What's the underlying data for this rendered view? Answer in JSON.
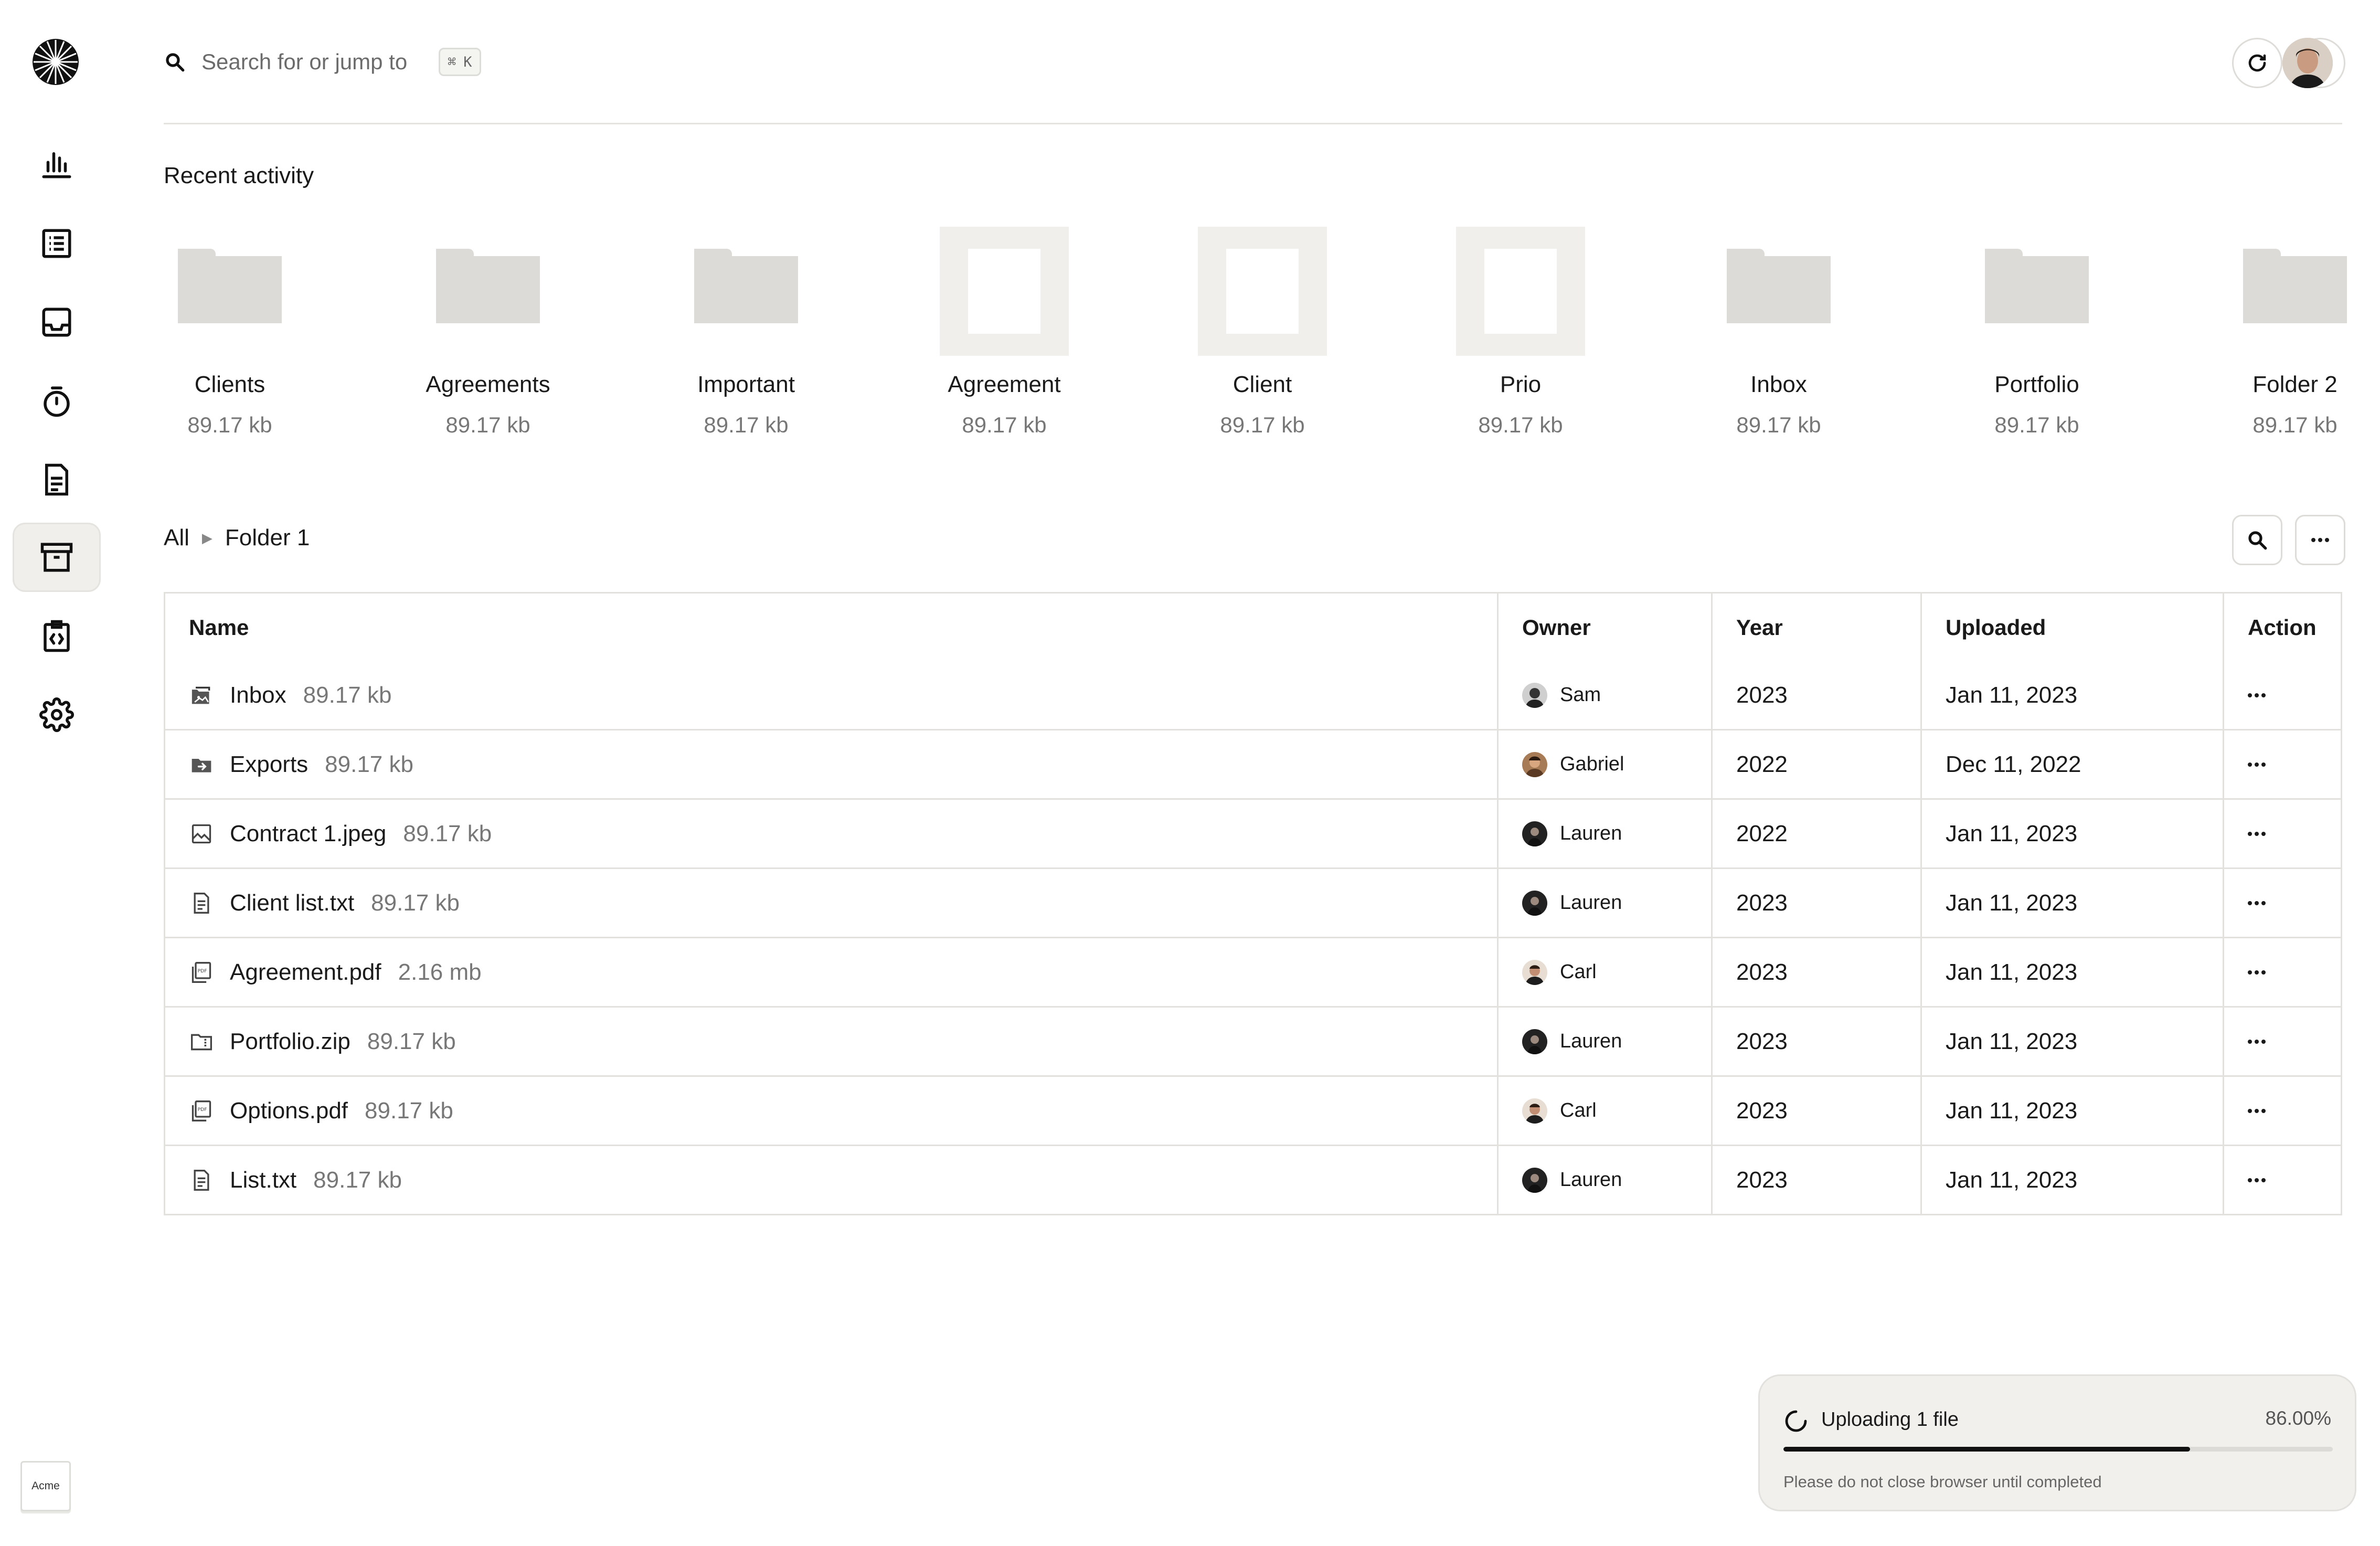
{
  "app": {
    "workspace_label": "Acme"
  },
  "search": {
    "placeholder": "Search for or jump to",
    "shortcut_symbol": "⌘",
    "shortcut_key": "K"
  },
  "sidebar": {
    "items": [
      {
        "icon": "bar-chart-icon",
        "active": false
      },
      {
        "icon": "list-icon",
        "active": false
      },
      {
        "icon": "inbox-icon",
        "active": false
      },
      {
        "icon": "timer-icon",
        "active": false
      },
      {
        "icon": "document-icon",
        "active": false
      },
      {
        "icon": "archive-icon",
        "active": true
      },
      {
        "icon": "code-file-icon",
        "active": false
      },
      {
        "icon": "gear-icon",
        "active": false
      }
    ]
  },
  "header_actions": [
    {
      "icon": "refresh-icon"
    },
    {
      "icon": "bell-icon"
    },
    {
      "icon": "user-avatar"
    }
  ],
  "recent": {
    "title": "Recent activity",
    "items": [
      {
        "name": "Clients",
        "size": "89.17 kb",
        "kind": "folder"
      },
      {
        "name": "Agreements",
        "size": "89.17 kb",
        "kind": "folder"
      },
      {
        "name": "Important",
        "size": "89.17 kb",
        "kind": "folder"
      },
      {
        "name": "Agreement",
        "size": "89.17 kb",
        "kind": "file"
      },
      {
        "name": "Client",
        "size": "89.17 kb",
        "kind": "file"
      },
      {
        "name": "Prio",
        "size": "89.17 kb",
        "kind": "file"
      },
      {
        "name": "Inbox",
        "size": "89.17 kb",
        "kind": "folder"
      },
      {
        "name": "Portfolio",
        "size": "89.17 kb",
        "kind": "folder"
      },
      {
        "name": "Folder 2",
        "size": "89.17 kb",
        "kind": "folder"
      }
    ]
  },
  "breadcrumb": {
    "root": "All",
    "current": "Folder 1"
  },
  "toolbar": [
    {
      "icon": "search-icon"
    },
    {
      "icon": "filter-icon"
    },
    {
      "icon": "more-icon"
    }
  ],
  "table": {
    "columns": {
      "name": "Name",
      "owner": "Owner",
      "year": "Year",
      "uploaded": "Uploaded",
      "action": "Action"
    },
    "rows": [
      {
        "icon": "image-folder-icon",
        "name": "Inbox",
        "size": "89.17 kb",
        "owner": "Sam",
        "year": "2023",
        "uploaded": "Jan 11, 2023"
      },
      {
        "icon": "folder-arrow-icon",
        "name": "Exports",
        "size": "89.17 kb",
        "owner": "Gabriel",
        "year": "2022",
        "uploaded": "Dec 11, 2022"
      },
      {
        "icon": "image-icon",
        "name": "Contract 1.jpeg",
        "size": "89.17 kb",
        "owner": "Lauren",
        "year": "2022",
        "uploaded": "Jan 11, 2023"
      },
      {
        "icon": "text-file-icon",
        "name": "Client list.txt",
        "size": "89.17 kb",
        "owner": "Lauren",
        "year": "2023",
        "uploaded": "Jan 11, 2023"
      },
      {
        "icon": "pdf-icon",
        "name": "Agreement.pdf",
        "size": "2.16 mb",
        "owner": "Carl",
        "year": "2023",
        "uploaded": "Jan 11, 2023"
      },
      {
        "icon": "zip-folder-icon",
        "name": "Portfolio.zip",
        "size": "89.17 kb",
        "owner": "Lauren",
        "year": "2023",
        "uploaded": "Jan 11, 2023"
      },
      {
        "icon": "pdf-icon",
        "name": "Options.pdf",
        "size": "89.17 kb",
        "owner": "Carl",
        "year": "2023",
        "uploaded": "Jan 11, 2023"
      },
      {
        "icon": "text-file-icon",
        "name": "List.txt",
        "size": "89.17 kb",
        "owner": "Lauren",
        "year": "2023",
        "uploaded": "Jan 11, 2023"
      }
    ]
  },
  "upload": {
    "title": "Uploading 1 file",
    "percent_label": "86.00%",
    "progress": 0.74,
    "note": "Please do not close browser until completed"
  },
  "colors": {
    "folder": "#dcdbd7",
    "file_frame": "#f0efec",
    "accent": "#111111"
  }
}
